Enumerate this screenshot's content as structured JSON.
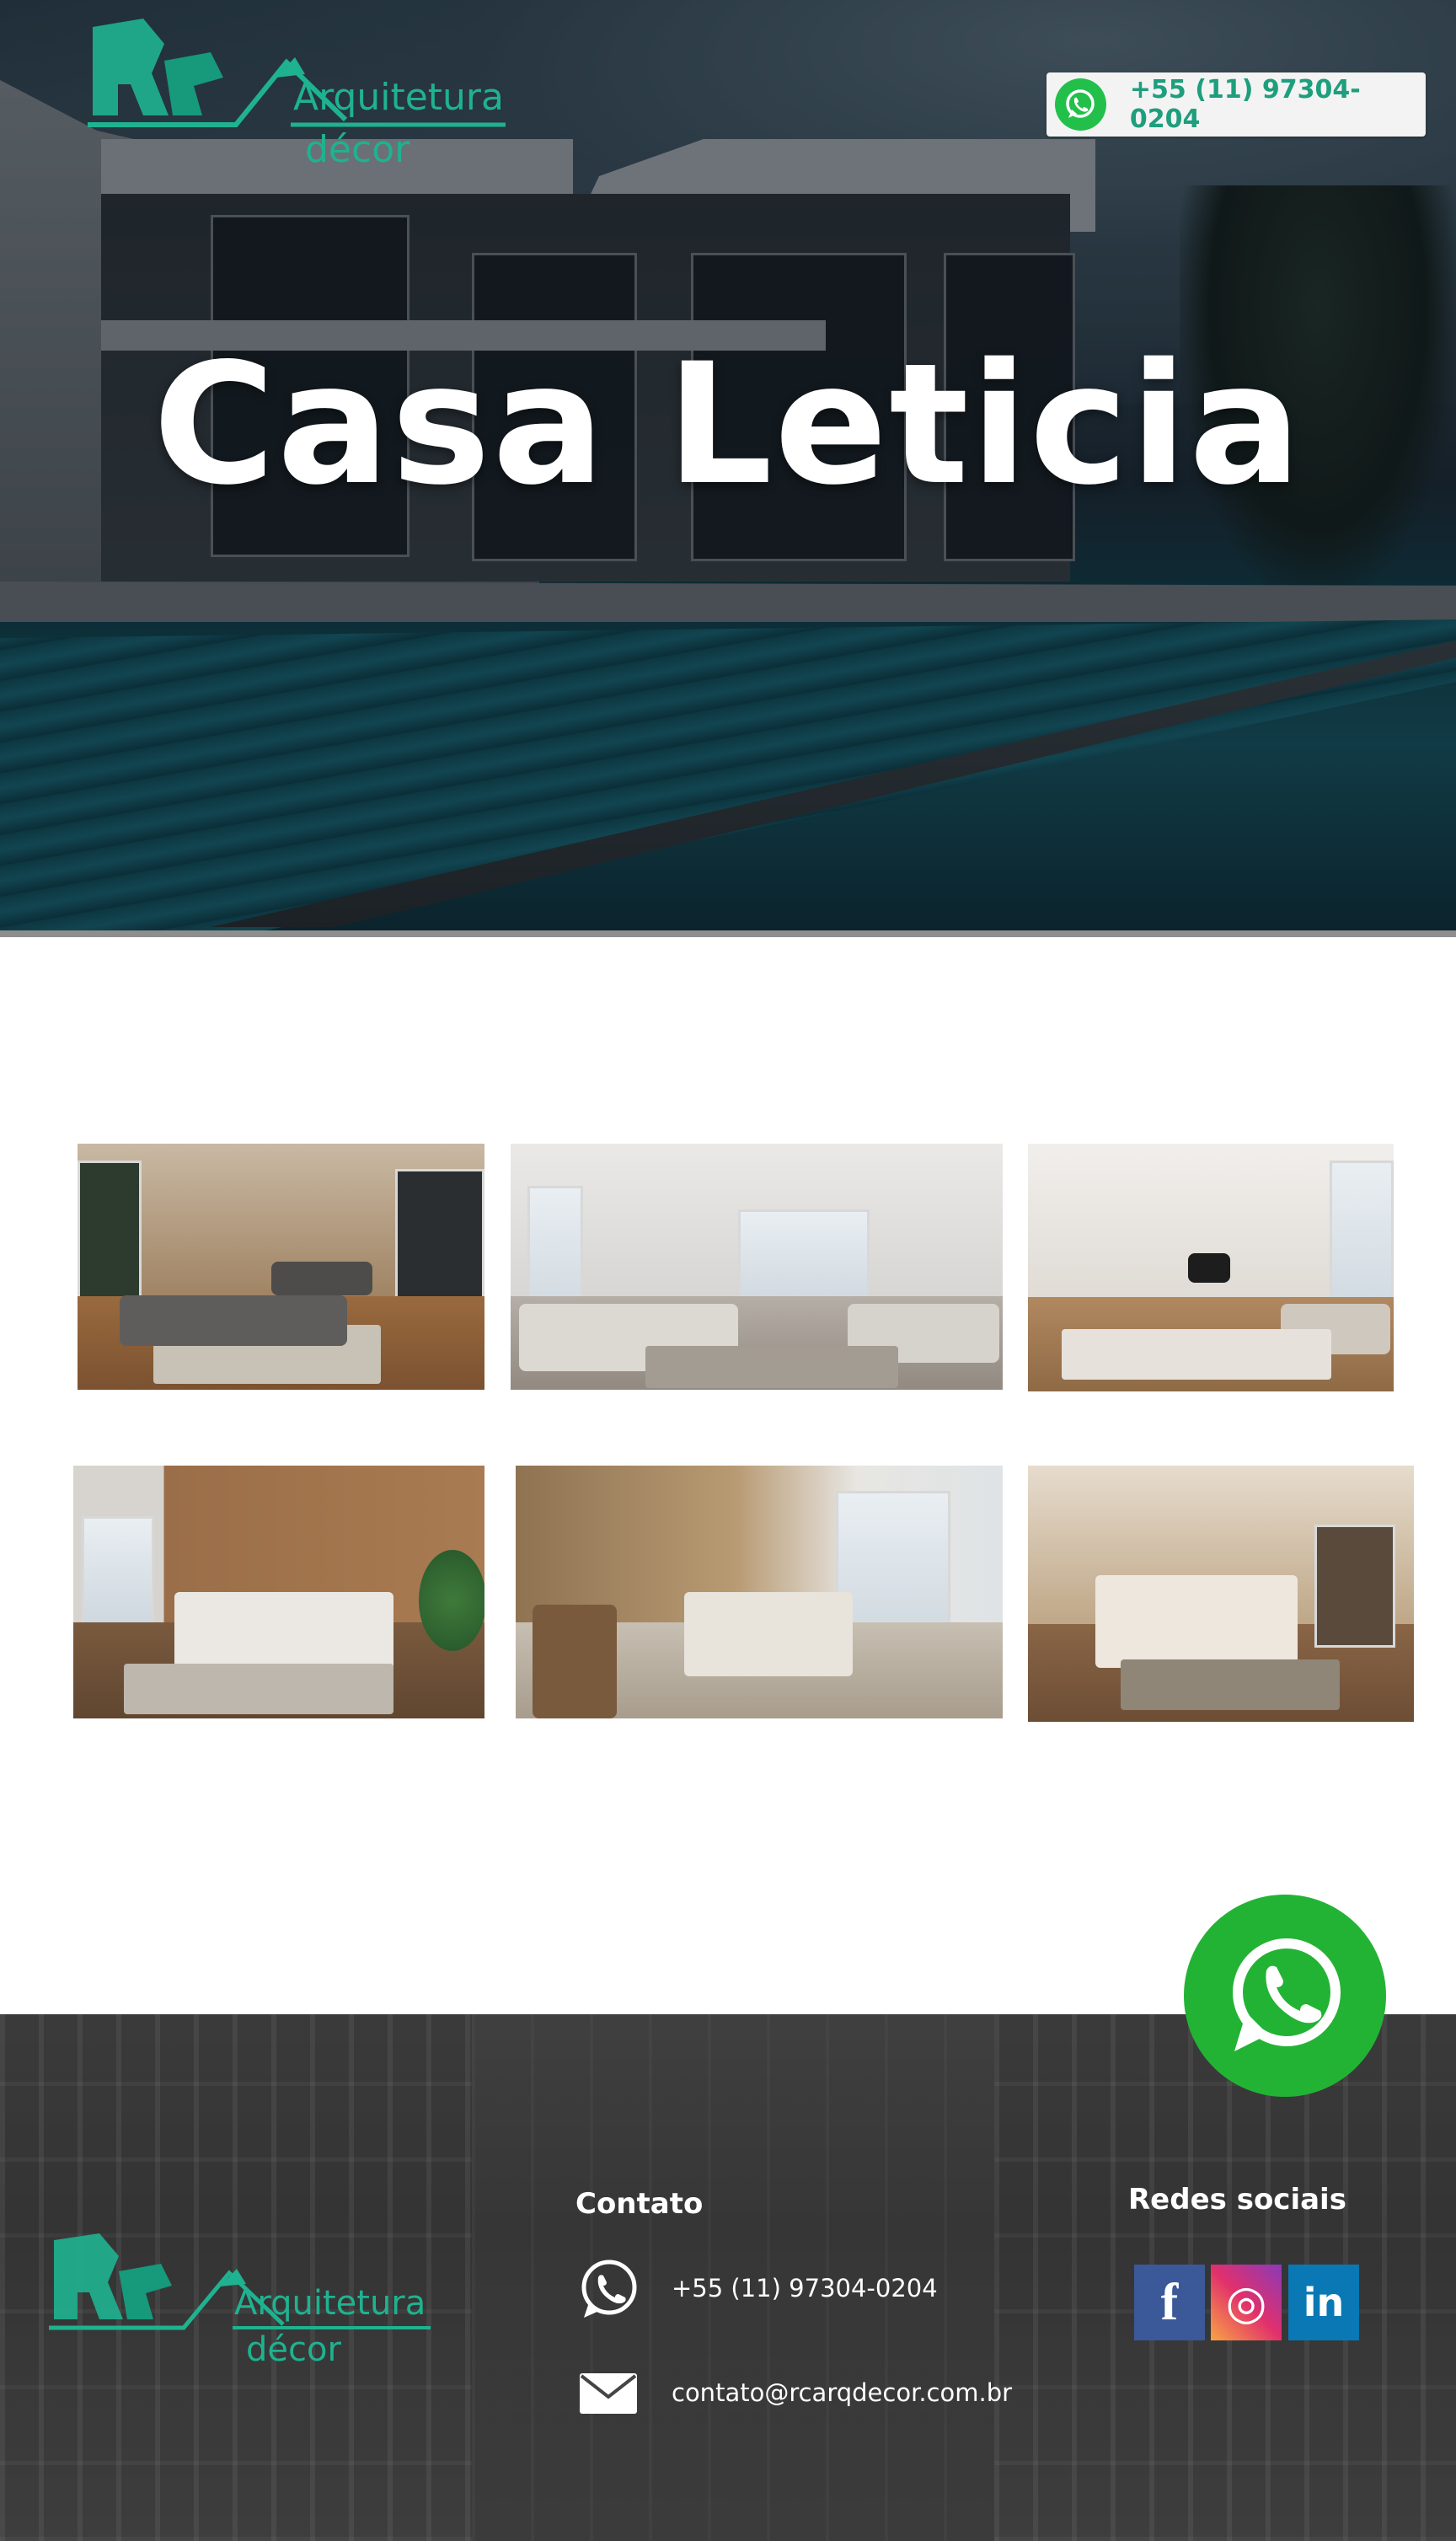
{
  "header": {
    "logo": {
      "line1": "Arquitetura",
      "line2": "décor",
      "mark_text": "RC"
    },
    "phone": "+55 (11) 97304-0204"
  },
  "hero": {
    "title": "Casa Leticia"
  },
  "gallery": {
    "row1": [
      {
        "alt": "Sala de estar com sofá cinza e piso de madeira"
      },
      {
        "alt": "Sala de estar clara com sofás brancos"
      },
      {
        "alt": "Sala de estar com TV e sofá bege"
      }
    ],
    "row2": [
      {
        "alt": "Quarto com parede de madeira e cama cinza"
      },
      {
        "alt": "Quarto com cama, poltrona e janelas amplas"
      },
      {
        "alt": "Quarto com iluminação indireta e cama bege"
      }
    ]
  },
  "footer": {
    "contact_heading": "Contato",
    "phone": "+55 (11) 97304-0204",
    "email": "contato@rcarqdecor.com.br",
    "social_heading": "Redes sociais",
    "social": [
      {
        "name": "facebook-icon",
        "glyph": "f",
        "color": "#3b5998"
      },
      {
        "name": "instagram-icon",
        "glyph": "◎",
        "color": "#d6306f"
      },
      {
        "name": "linkedin-icon",
        "glyph": "in",
        "color": "#0a78b5"
      }
    ]
  },
  "colors": {
    "brand": "#1fb290",
    "whatsapp": "#22b335"
  }
}
